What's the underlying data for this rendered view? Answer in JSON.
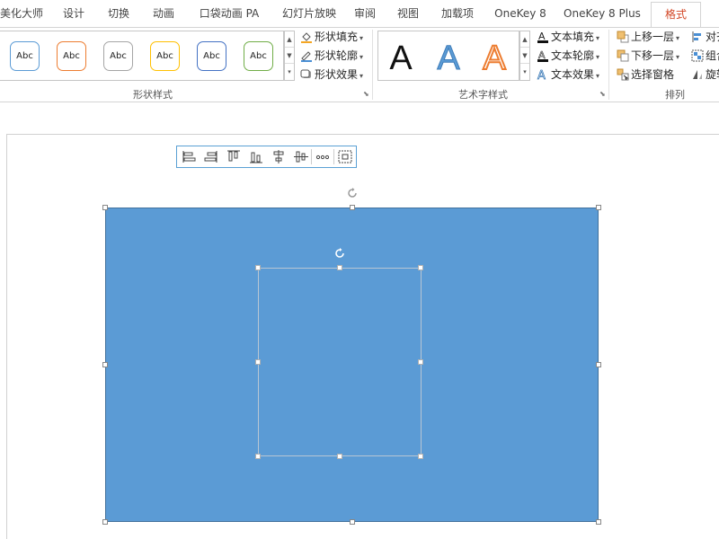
{
  "tabs": [
    {
      "label": "美化大师"
    },
    {
      "label": "设计"
    },
    {
      "label": "切换"
    },
    {
      "label": "动画"
    },
    {
      "label": "口袋动画 PA"
    },
    {
      "label": "幻灯片放映"
    },
    {
      "label": "审阅"
    },
    {
      "label": "视图"
    },
    {
      "label": "加载项"
    },
    {
      "label": "OneKey 8"
    },
    {
      "label": "OneKey 8 Plus"
    },
    {
      "label": "格式"
    }
  ],
  "shape_styles": {
    "group_label": "形状样式",
    "swatches": [
      {
        "label": "Abc",
        "color": "#5b9bd5"
      },
      {
        "label": "Abc",
        "color": "#ed7d31"
      },
      {
        "label": "Abc",
        "color": "#a5a5a5"
      },
      {
        "label": "Abc",
        "color": "#ffc000"
      },
      {
        "label": "Abc",
        "color": "#4472c4"
      },
      {
        "label": "Abc",
        "color": "#70ad47"
      }
    ],
    "commands": {
      "fill": "形状填充",
      "outline": "形状轮廓",
      "effects": "形状效果"
    }
  },
  "wordart": {
    "group_label": "艺术字样式",
    "letters": [
      "A",
      "A",
      "A"
    ],
    "commands": {
      "fill": "文本填充",
      "outline": "文本轮廓",
      "effects": "文本效果"
    }
  },
  "arrange": {
    "group_label": "排列",
    "commands": {
      "bring_forward": "上移一层",
      "send_backward": "下移一层",
      "selection_pane": "选择窗格",
      "align": "对齐",
      "group": "组合",
      "rotate": "旋转"
    }
  },
  "canvas": {
    "shape_color": "#5b9bd5"
  }
}
